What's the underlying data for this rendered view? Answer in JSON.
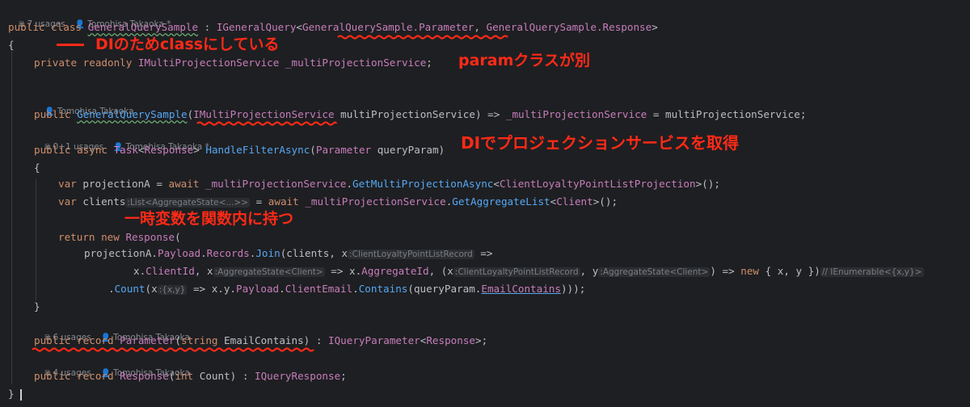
{
  "meta": {
    "m1": {
      "usages": "7 usages",
      "author": "Tomohisa Takaoka *"
    },
    "m2": {
      "author": "Tomohisa Takaoka"
    },
    "m3": {
      "usages": "0+1 usages",
      "author": "Tomohisa Takaoka *"
    },
    "m4": {
      "usages": "6 usages",
      "author": "Tomohisa Takaoka"
    },
    "m5": {
      "usages": "4 usages",
      "author": "Tomohisa Takaoka"
    }
  },
  "code": {
    "l1": {
      "t1": "public",
      "t2": "class",
      "t3": "GeneralQuerySample",
      "t4": " : ",
      "t5": "IGeneralQuery",
      "t6": "<",
      "t7": "GeneralQuerySample.Parameter",
      "t8": ", ",
      "t9": "GeneralQuerySample.Response",
      "t10": ">"
    },
    "l2": {
      "t1": "{"
    },
    "l3": {
      "t1": "private readonly",
      "t2": "IMultiProjectionService",
      "t3": " ",
      "t4": "_multiProjectionService",
      "t5": ";"
    },
    "l4": {
      "t1": "public",
      "t2": "GeneralQuerySample",
      "t3": "(",
      "t4": "IMultiProjectionService",
      "t5": " multiProjectionService) => ",
      "t6": "_multiProjectionService",
      "t7": " = multiProjectionService;"
    },
    "l5": {
      "t1": "public async",
      "t2": "Task",
      "t3": "<",
      "t4": "Response",
      "t5": "> ",
      "t6": "HandleFilterAsync",
      "t7": "(",
      "t8": "Parameter",
      "t9": " queryParam)"
    },
    "l6": {
      "t1": "{"
    },
    "l7": {
      "t1": "var",
      "t2": " projectionA = ",
      "t3": "await",
      "t4": " ",
      "t5": "_multiProjectionService",
      "t6": ".",
      "t7": "GetMultiProjectionAsync",
      "t8": "<",
      "t9": "ClientLoyaltyPointListProjection",
      "t10": ">();"
    },
    "l8": {
      "t1": "var",
      "t2": " clients",
      "t3": ":List<AggregateState<...>>",
      "t4": " = ",
      "t5": "await",
      "t6": " ",
      "t7": "_multiProjectionService",
      "t8": ".",
      "t9": "GetAggregateList",
      "t10": "<",
      "t11": "Client",
      "t12": ">();"
    },
    "l9": {
      "t1": "return",
      "t2": " ",
      "t3": "new",
      "t4": " ",
      "t5": "Response",
      "t6": "("
    },
    "l10": {
      "t1": "projectionA.",
      "t2": "Payload",
      "t3": ".",
      "t4": "Records",
      "t5": ".",
      "t6": "Join",
      "t7": "(clients, x",
      "t8": ":ClientLoyaltyPointListRecord",
      "t9": " =>"
    },
    "l11": {
      "t1": "x.",
      "t2": "ClientId",
      "t3": ", x",
      "t4": ":AggregateState<Client>",
      "t5": " => x.",
      "t6": "AggregateId",
      "t7": ", (x",
      "t8": ":ClientLoyaltyPointListRecord",
      "t9": ", y",
      "t10": ":AggregateState<Client>",
      "t11": ") => ",
      "t12": "new",
      "t13": " { x, y })",
      "t14": "// IEnumerable<{x,y}>"
    },
    "l12": {
      "t1": ".",
      "t2": "Count",
      "t3": "(x",
      "t4": ":{x,y}",
      "t5": " => x.y.",
      "t6": "Payload",
      "t7": ".",
      "t8": "ClientEmail",
      "t9": ".",
      "t10": "Contains",
      "t11": "(queryParam.",
      "t12": "EmailContains",
      "t13": ")));"
    },
    "l13": {
      "t1": "}"
    },
    "l14": {
      "t1": "public record",
      "t2": "Parameter",
      "t3": "(",
      "t4": "string",
      "t5": " EmailContains) : ",
      "t6": "IQueryParameter",
      "t7": "<",
      "t8": "Response",
      "t9": ">;"
    },
    "l15": {
      "t1": "public record",
      "t2": "Response",
      "t3": "(",
      "t4": "int",
      "t5": " Count) : ",
      "t6": "IQueryResponse",
      "t7": ";"
    },
    "l16": {
      "t1": "}"
    }
  },
  "annotations": {
    "a1": "DIのためclassにしている",
    "a2": "paramクラスが別",
    "a3": "DIでプロジェクションサービスを取得",
    "a4": "一時変数を関数内に持つ"
  },
  "icons": {
    "usage": "usages-icon",
    "author": "person-icon"
  },
  "colors": {
    "background": "#1e1f22",
    "keyword": "#cf8e6d",
    "type": "#c77dbb",
    "method": "#56a8f5",
    "text": "#bcbec4",
    "annotation": "#ff2a17"
  }
}
